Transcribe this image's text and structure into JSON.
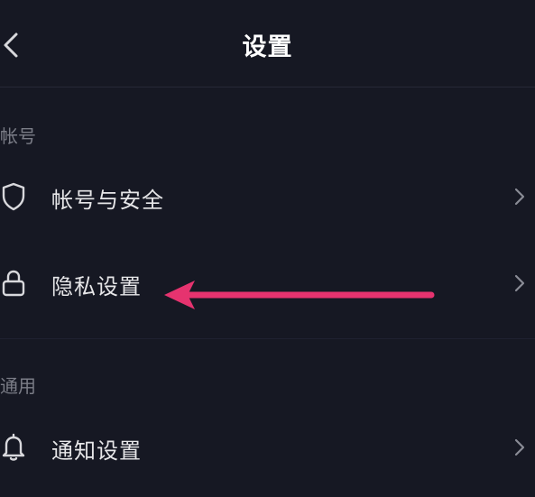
{
  "header": {
    "title": "设置",
    "back_icon": "chevron-left-icon"
  },
  "sections": [
    {
      "label": "帐号",
      "items": [
        {
          "label": "帐号与安全",
          "icon": "shield-icon"
        },
        {
          "label": "隐私设置",
          "icon": "lock-icon"
        }
      ]
    },
    {
      "label": "通用",
      "items": [
        {
          "label": "通知设置",
          "icon": "bell-icon"
        }
      ]
    }
  ],
  "annotation": {
    "icon": "left-arrow-icon",
    "color": "#e6336f"
  },
  "colors": {
    "background": "#161823",
    "text": "#e6e6e8",
    "muted": "#7b7d87",
    "accent": "#e6336f"
  }
}
